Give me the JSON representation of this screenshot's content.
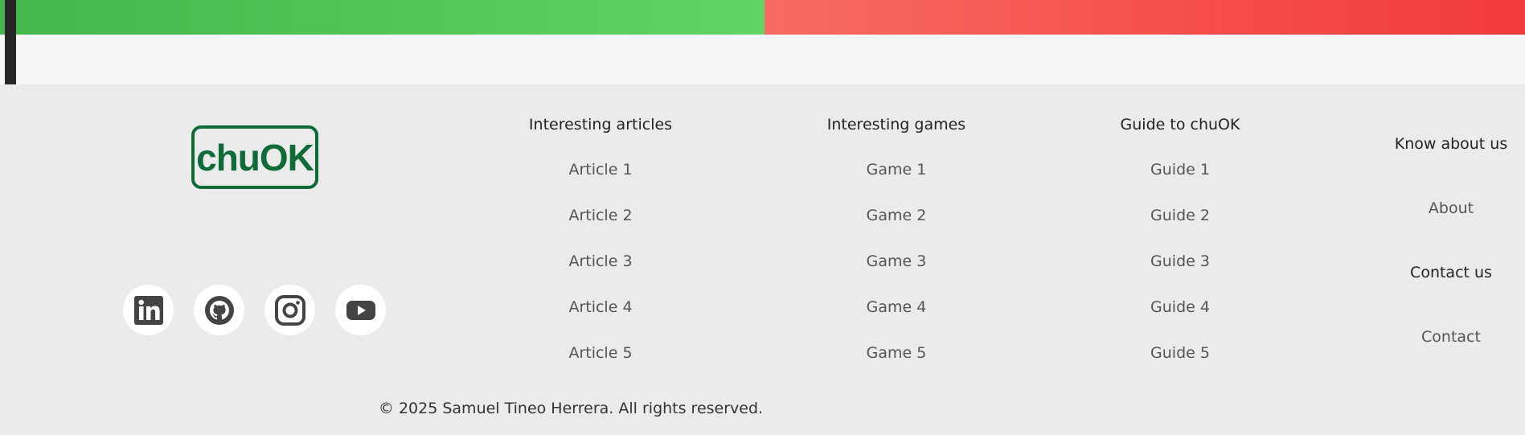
{
  "colors": {
    "green_bar": "#44b64a",
    "red_bar": "#f33a3c",
    "logo_green": "#0f6b37",
    "footer_bg": "#ebebeb"
  },
  "brand": {
    "logo_text": "chuOK"
  },
  "socials": [
    {
      "icon": "linkedin-icon"
    },
    {
      "icon": "github-icon"
    },
    {
      "icon": "instagram-icon"
    },
    {
      "icon": "youtube-icon"
    }
  ],
  "columns": {
    "articles": {
      "title": "Interesting articles",
      "items": [
        "Article 1",
        "Article 2",
        "Article 3",
        "Article 4",
        "Article 5"
      ]
    },
    "games": {
      "title": "Interesting games",
      "items": [
        "Game 1",
        "Game 2",
        "Game 3",
        "Game 4",
        "Game 5"
      ]
    },
    "guide": {
      "title": "Guide to chuOK",
      "items": [
        "Guide 1",
        "Guide 2",
        "Guide 3",
        "Guide 4",
        "Guide 5"
      ]
    },
    "about": {
      "heading1": "Know about us",
      "link1": "About",
      "heading2": "Contact us",
      "link2": "Contact"
    }
  },
  "copyright": "© 2025 Samuel Tineo Herrera. All rights reserved."
}
